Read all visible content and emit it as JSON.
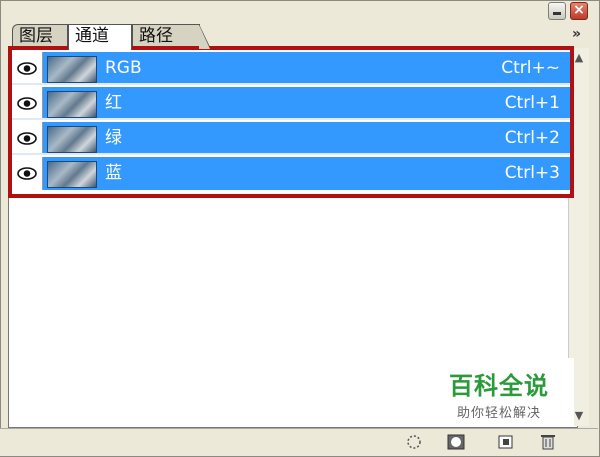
{
  "tabs": [
    "图层",
    "通道",
    "路径"
  ],
  "active_tab": "通道",
  "panel_menu_glyph": "»",
  "channels": [
    {
      "name": "RGB",
      "shortcut": "Ctrl+~",
      "visible": true
    },
    {
      "name": "红",
      "shortcut": "Ctrl+1",
      "visible": true
    },
    {
      "name": "绿",
      "shortcut": "Ctrl+2",
      "visible": true
    },
    {
      "name": "蓝",
      "shortcut": "Ctrl+3",
      "visible": true
    }
  ],
  "window_buttons": {
    "minimize": "minimize-icon",
    "close": "×"
  },
  "bottom_icons": [
    "load-selection-icon",
    "save-selection-icon",
    "new-channel-icon",
    "trash-icon"
  ],
  "watermark": {
    "title": "百科全说",
    "subtitle": "助你轻松解决"
  },
  "colors": {
    "selection": "#3399ff",
    "highlight_border": "#b01010",
    "watermark_green": "#2a9a3a"
  }
}
